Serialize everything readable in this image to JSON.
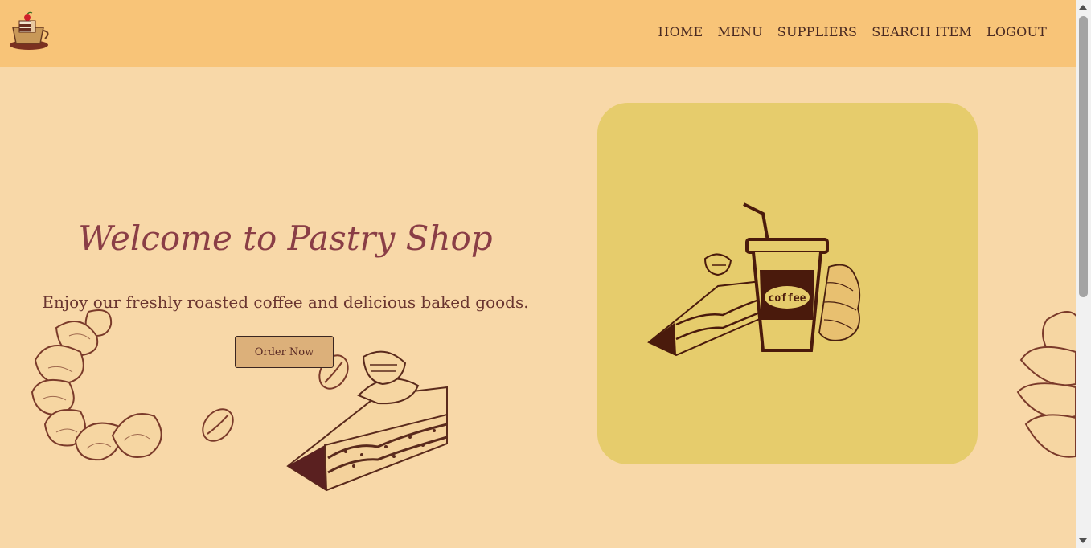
{
  "nav": {
    "logo_icon": "pastry-cup-logo-icon",
    "links": [
      "HOME",
      "MENU",
      "SUPPLIERS",
      "SEARCH ITEM",
      "LOGOUT"
    ]
  },
  "hero": {
    "title": "Welcome to Pastry Shop",
    "subtitle": "Enjoy our freshly roasted coffee and delicious baked goods.",
    "button": "Order Now",
    "cup_label": "coffee"
  },
  "colors": {
    "navbar": "#f8c478",
    "background": "#f8d8a8",
    "card": "#e6cc6c",
    "title": "#8a3e46",
    "button": "#dcb07a",
    "sketch_line": "#5a2a1c"
  }
}
